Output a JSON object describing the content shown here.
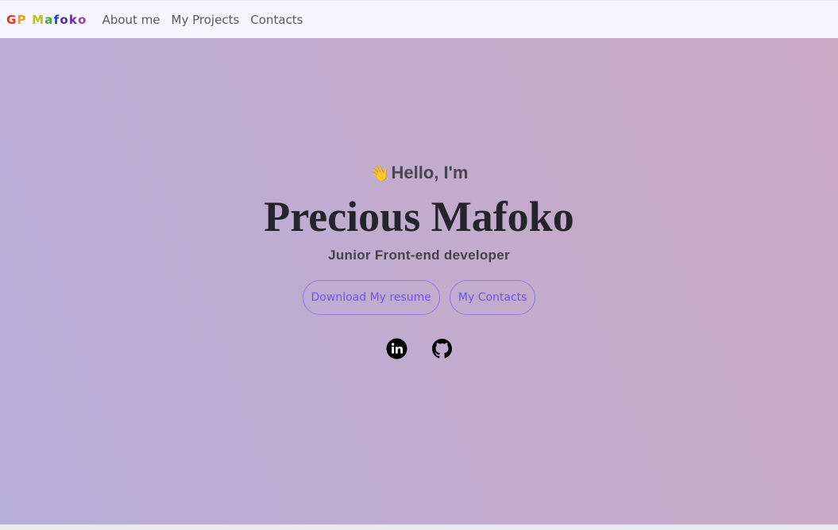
{
  "nav": {
    "brand_letters": [
      {
        "char": "G",
        "color": "#e8341c"
      },
      {
        "char": "P",
        "color": "#f29b16"
      },
      {
        "char": " ",
        "color": "#000000"
      },
      {
        "char": "M",
        "color": "#b8c414"
      },
      {
        "char": "a",
        "color": "#3aa83c"
      },
      {
        "char": "f",
        "color": "#1e3cd8"
      },
      {
        "char": "o",
        "color": "#4b2bb5"
      },
      {
        "char": "k",
        "color": "#6a2ab8"
      },
      {
        "char": "o",
        "color": "#a03dc8"
      }
    ],
    "links": [
      "About me",
      "My Projects",
      "Contacts"
    ]
  },
  "hero": {
    "wave_emoji": "👋",
    "greeting": "Hello, I'm",
    "name": "Precious Mafoko",
    "role": "Junior Front-end developer",
    "buttons": {
      "resume": "Download My resume",
      "contacts": "My Contacts"
    },
    "socials": [
      {
        "icon": "linkedin-icon"
      },
      {
        "icon": "github-icon"
      }
    ]
  },
  "colors": {
    "accent": "#6a55e8",
    "navbar_bg": "#f7f6fc"
  }
}
